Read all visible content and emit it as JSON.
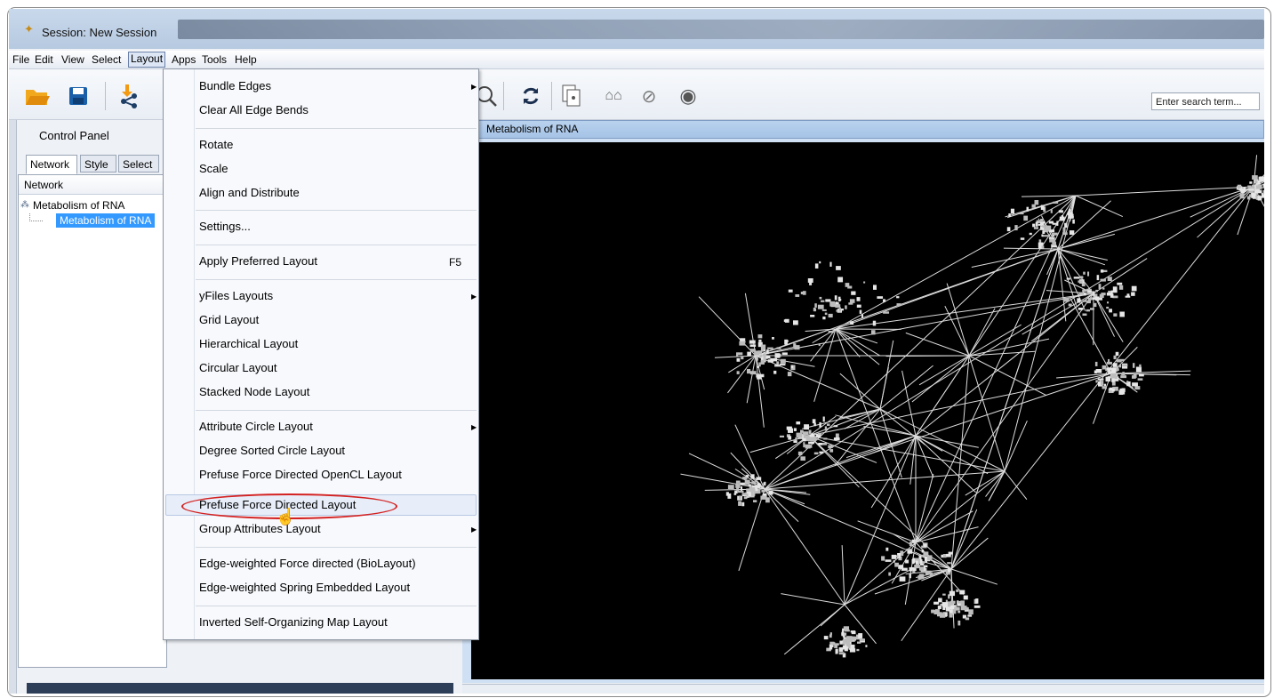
{
  "window": {
    "title": "Session: New Session"
  },
  "menubar": [
    "File",
    "Edit",
    "View",
    "Select",
    "Layout",
    "Apps",
    "Tools",
    "Help"
  ],
  "active_menu": "Layout",
  "toolbar": {
    "icons": [
      "open-folder-icon",
      "save-icon",
      "import-network-icon",
      "zoom-icon",
      "refresh-icon",
      "export-icon",
      "show-all-icon",
      "hide-icon",
      "eye-icon"
    ],
    "search_placeholder": "Enter search term..."
  },
  "control_panel": {
    "title": "Control Panel",
    "tabs": [
      "Network",
      "Style",
      "Select"
    ],
    "active_tab": "Network",
    "network_header": "Network",
    "tree": {
      "root": "Metabolism of RNA",
      "child": "Metabolism of RNA"
    }
  },
  "network_view": {
    "title": "Metabolism of RNA"
  },
  "layout_menu": {
    "items": [
      {
        "label": "Bundle Edges",
        "submenu": true
      },
      {
        "label": "Clear All Edge Bends"
      },
      {
        "label": "Rotate"
      },
      {
        "label": "Scale"
      },
      {
        "label": "Align and Distribute"
      },
      {
        "label": "Settings..."
      },
      {
        "label": "Apply Preferred Layout",
        "shortcut": "F5"
      },
      {
        "label": "yFiles Layouts",
        "submenu": true
      },
      {
        "label": "Grid Layout"
      },
      {
        "label": "Hierarchical Layout"
      },
      {
        "label": "Circular Layout"
      },
      {
        "label": "Stacked Node Layout"
      },
      {
        "label": "Attribute Circle Layout",
        "submenu": true
      },
      {
        "label": "Degree Sorted Circle Layout"
      },
      {
        "label": "Prefuse Force Directed OpenCL Layout"
      },
      {
        "label": "Prefuse Force Directed Layout",
        "highlighted": true
      },
      {
        "label": "Group Attributes Layout",
        "submenu": true
      },
      {
        "label": "Edge-weighted Force directed (BioLayout)"
      },
      {
        "label": "Edge-weighted Spring Embedded Layout"
      },
      {
        "label": "Inverted Self-Organizing Map Layout"
      }
    ]
  },
  "colors": {
    "highlight_ellipse": "#d42222",
    "selection": "#3399ff",
    "canvas": "#000000"
  }
}
